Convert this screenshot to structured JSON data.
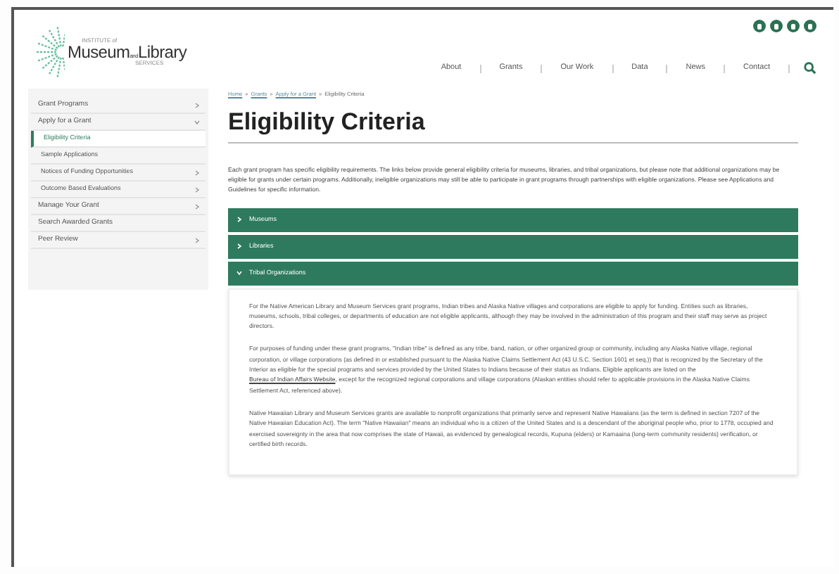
{
  "logo": {
    "line_1": "INSTITUTE of",
    "line_2a": "Museum",
    "line_2b": "and",
    "line_2c": "Library",
    "line_3": "SERVICES"
  },
  "nav": [
    "About",
    "Grants",
    "Our Work",
    "Data",
    "News",
    "Contact"
  ],
  "sidebar": {
    "items": [
      {
        "label": "Grant Programs",
        "expandable": true,
        "expanded": false,
        "selected": false
      },
      {
        "label": "Apply for a Grant",
        "expandable": true,
        "expanded": true,
        "selected": false,
        "children": [
          {
            "label": "Eligibility Criteria",
            "expandable": false,
            "selected": true
          },
          {
            "label": "Sample Applications",
            "expandable": false,
            "selected": false
          },
          {
            "label": "Notices of Funding Opportunities",
            "expandable": true,
            "expanded": false,
            "selected": false
          },
          {
            "label": "Outcome Based Evaluations",
            "expandable": true,
            "expanded": false,
            "selected": false
          }
        ]
      },
      {
        "label": "Manage Your Grant",
        "expandable": true,
        "expanded": false,
        "selected": false
      },
      {
        "label": "Search Awarded Grants",
        "expandable": false,
        "selected": false
      },
      {
        "label": "Peer Review",
        "expandable": true,
        "expanded": false,
        "selected": false
      }
    ]
  },
  "breadcrumb": {
    "links": [
      "Home",
      "Grants",
      "Apply for a Grant"
    ],
    "separator": "»",
    "current": "Eligibility Criteria"
  },
  "title": "Eligibility Criteria",
  "intro": "Each grant program has specific eligibility requirements. The links below provide general eligibility criteria for museums, libraries, and tribal organizations, but please note that additional organizations may be eligible for grants under certain programs. Additionally, ineligible organizations may still be able to participate in grant programs through partnerships with eligible organizations. Please see Applications and Guidelines for specific information.",
  "accordion": [
    {
      "label": "Museums",
      "expanded": false
    },
    {
      "label": "Libraries",
      "expanded": false
    },
    {
      "label": "Tribal Organizations",
      "expanded": true,
      "paragraphs": [
        [
          {
            "text": "For the Native American Library and Museum Services grant programs, Indian tribes and Alaska Native villages and corporations are eligible to apply for funding. Entities such as libraries, museums, schools, tribal colleges, or departments of education are not eligible applicants, although they may be involved in the administration of this program and their staff may serve as project directors."
          }
        ],
        [
          {
            "text": "For purposes of funding under these grant programs, \"Indian tribe\" is defined as any tribe, band, nation, or other organized group or community, including any Alaska Native village, regional corporation, or village corporations (as defined in or established pursuant to the Alaska Native Claims Settlement Act (43 U.S.C. Section 1601 et seq.)) that is recognized by the Secretary of the Interior as eligible for the special programs and services provided by the United States to Indians because of their status as Indians. Eligible applicants are listed on the "
          },
          {
            "text": "Bureau of Indian Affairs Website",
            "link": true
          },
          {
            "text": ", except for the recognized regional corporations and village corporations (Alaskan entities should refer to applicable provisions in the Alaska Native Claims Settlement Act, referenced above)."
          }
        ],
        [
          {
            "text": "Native Hawaiian Library and Museum Services grants are available to nonprofit organizations that primarily serve and represent Native Hawaiians (as the term is defined in section 7207 of the Native Hawaiian Education Act). The term \"Native Hawaiian\" means an individual who is a citizen of the United States and is a descendant of the aboriginal people who, prior to 1778, occupied and exercised sovereignty in the area that now comprises the state of Hawaii, as evidenced by genealogical records, Kupuna (elders) or Kamaaina (long-term community residents) verification, or certified birth records."
          }
        ]
      ]
    }
  ]
}
